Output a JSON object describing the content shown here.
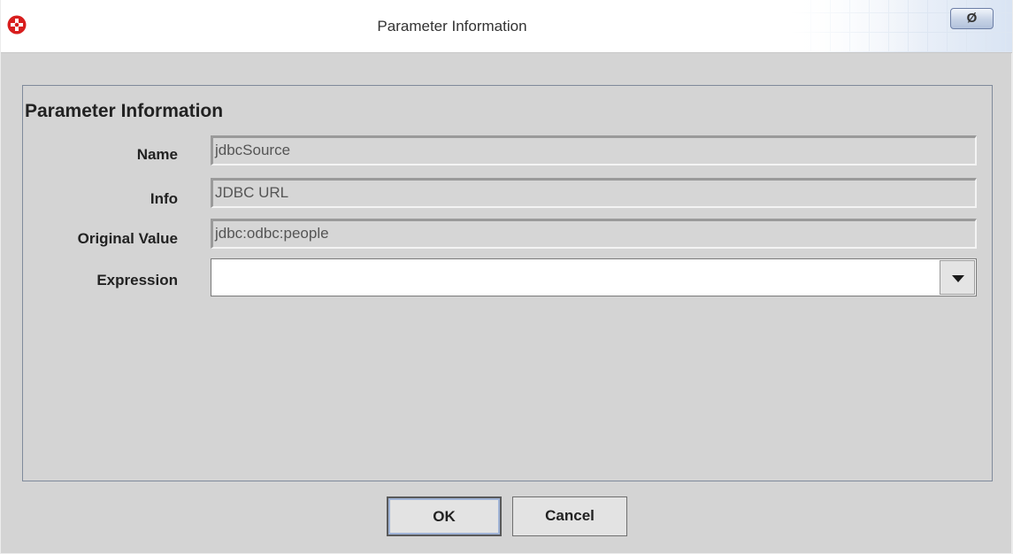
{
  "window": {
    "title": "Parameter Information",
    "title_button_label": "Ø"
  },
  "group": {
    "title": "Parameter Information"
  },
  "fields": {
    "name": {
      "label": "Name",
      "value": "jdbcSource"
    },
    "info": {
      "label": "Info",
      "value": "JDBC URL"
    },
    "original_value": {
      "label": "Original Value",
      "value": "jdbc:odbc:people"
    },
    "expression": {
      "label": "Expression",
      "value": ""
    }
  },
  "buttons": {
    "ok": "OK",
    "cancel": "Cancel"
  },
  "icons": {
    "app": "app-logo-icon",
    "dropdown": "chevron-down-icon"
  },
  "colors": {
    "dialog_background": "#d4d4d4",
    "app_icon_red": "#d81e1e"
  }
}
